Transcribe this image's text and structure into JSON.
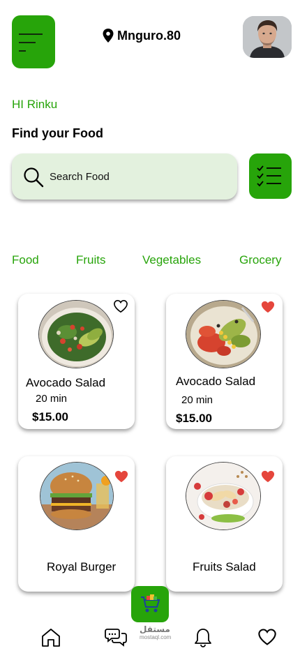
{
  "header": {
    "location": "Mnguro.80"
  },
  "greeting": "HI Rinku",
  "find_title": "Find your Food",
  "search": {
    "placeholder": "Search Food"
  },
  "categories": [
    "Food",
    "Fruits",
    "Vegetables",
    "Grocery"
  ],
  "colors": {
    "accent": "#27a40a",
    "search_bg": "#e3f1de",
    "heart_active": "#e5463c"
  },
  "cards": [
    {
      "name": "Avocado Salad",
      "time": "20 min",
      "price": "$15.00",
      "favorite": false
    },
    {
      "name": "Avocado Salad",
      "time": "20 min",
      "price": "$15.00",
      "favorite": true
    },
    {
      "name": "Royal Burger",
      "favorite": true
    },
    {
      "name": "Fruits Salad",
      "favorite": true
    }
  ],
  "watermark": {
    "line1": "مستقل",
    "line2": "mostaql.com"
  },
  "bottom_nav": {
    "items": [
      "home-icon",
      "chat-icon",
      "bell-icon",
      "heart-icon"
    ]
  }
}
